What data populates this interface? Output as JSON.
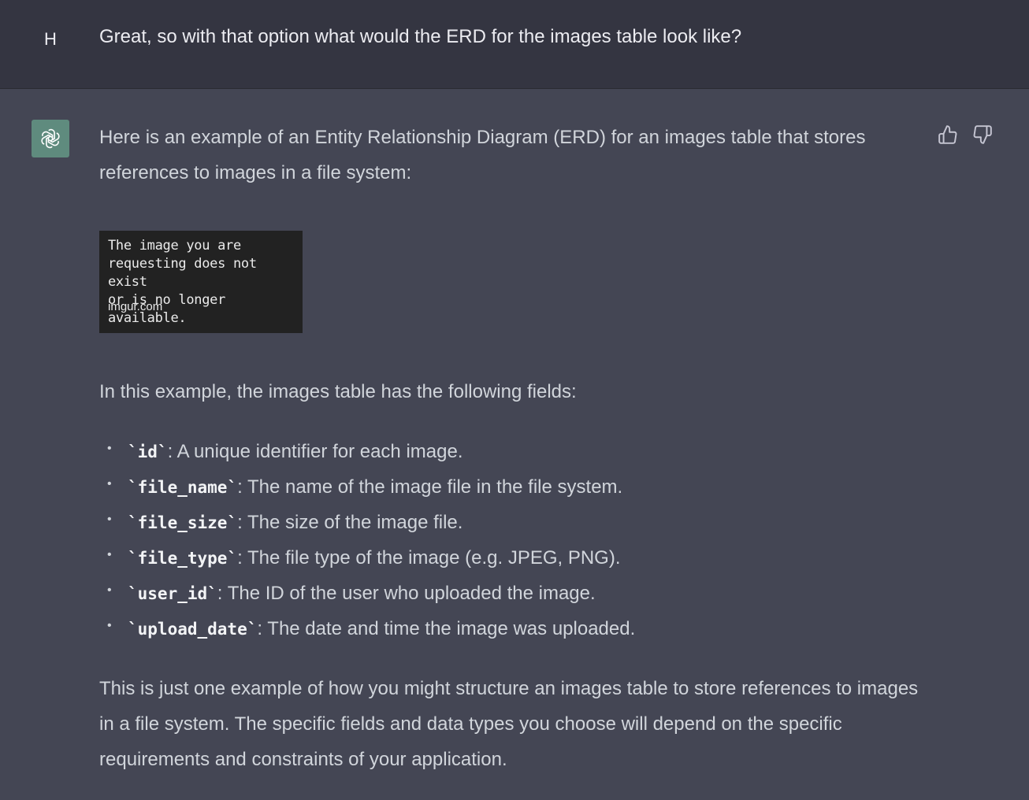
{
  "user": {
    "avatar_initial": "H",
    "message": "Great, so with that option what would the ERD for the images table look like?"
  },
  "assistant": {
    "avatar_icon": "openai-logo-icon",
    "intro": "Here is an example of an Entity Relationship Diagram (ERD) for an images table that stores references to images in a file system:",
    "image_placeholder": {
      "message": "The image you are\nrequesting does not exist\nor is no longer available.",
      "domain": "imgur.com"
    },
    "fields_intro": "In this example, the images table has the following fields:",
    "fields": [
      {
        "name": "`id`",
        "desc": ": A unique identifier for each image."
      },
      {
        "name": "`file_name`",
        "desc": ": The name of the image file in the file system."
      },
      {
        "name": "`file_size`",
        "desc": ": The size of the image file."
      },
      {
        "name": "`file_type`",
        "desc": ": The file type of the image (e.g. JPEG, PNG)."
      },
      {
        "name": "`user_id`",
        "desc": ": The ID of the user who uploaded the image."
      },
      {
        "name": "`upload_date`",
        "desc": ": The date and time the image was uploaded."
      }
    ],
    "closing": "This is just one example of how you might structure an images table to store references to images in a file system. The specific fields and data types you choose will depend on the specific requirements and constraints of your application."
  },
  "feedback": {
    "thumbs_up_icon": "thumbs-up-icon",
    "thumbs_down_icon": "thumbs-down-icon"
  },
  "colors": {
    "user_bg": "#343541",
    "assistant_bg": "#444654",
    "avatar_green": "#5f8b7e",
    "text": "#d1d5db"
  }
}
